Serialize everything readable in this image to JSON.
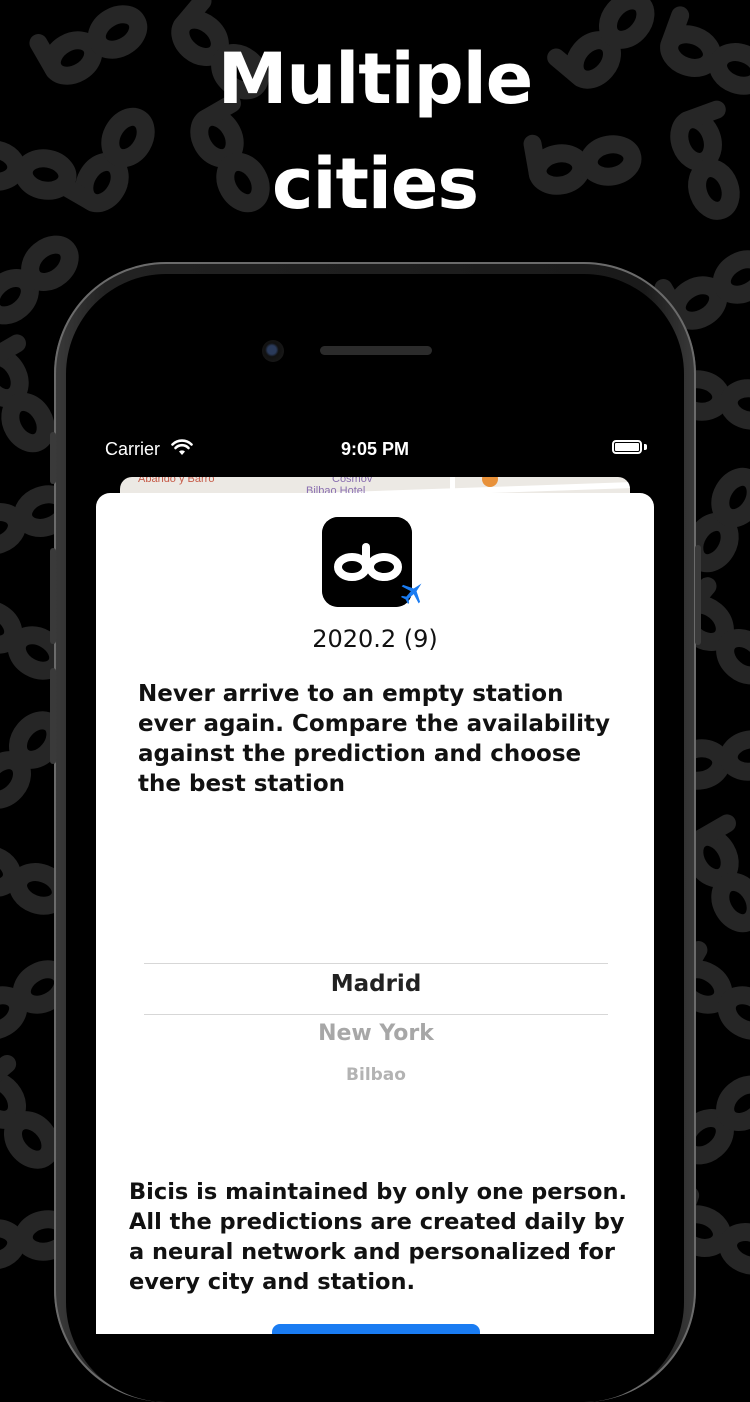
{
  "marketing": {
    "headline_line1": "Multiple",
    "headline_line2": "cities"
  },
  "status_bar": {
    "carrier": "Carrier",
    "time": "9:05 PM"
  },
  "map": {
    "label_left": "Abando y Barro",
    "label_center_1": "Cosmov",
    "label_center_2": "Bilbao Hotel"
  },
  "about_sheet": {
    "version": "2020.2 (9)",
    "promo_text": "Never arrive to an empty station ever again. Compare the availability against the prediction and choose the best station",
    "city_picker": {
      "options": [
        "Madrid",
        "New York",
        "Bilbao"
      ],
      "selected": "Madrid"
    },
    "about_text": "Bicis is maintained by only one person. All the predictions are created daily by a neural network and personalized for every city and station."
  },
  "colors": {
    "background": "#000000",
    "accent": "#1a7cf2",
    "sheet": "#ffffff"
  },
  "icons": [
    "app-logo-icon",
    "airplane-badge-icon",
    "wifi-icon",
    "battery-icon"
  ]
}
